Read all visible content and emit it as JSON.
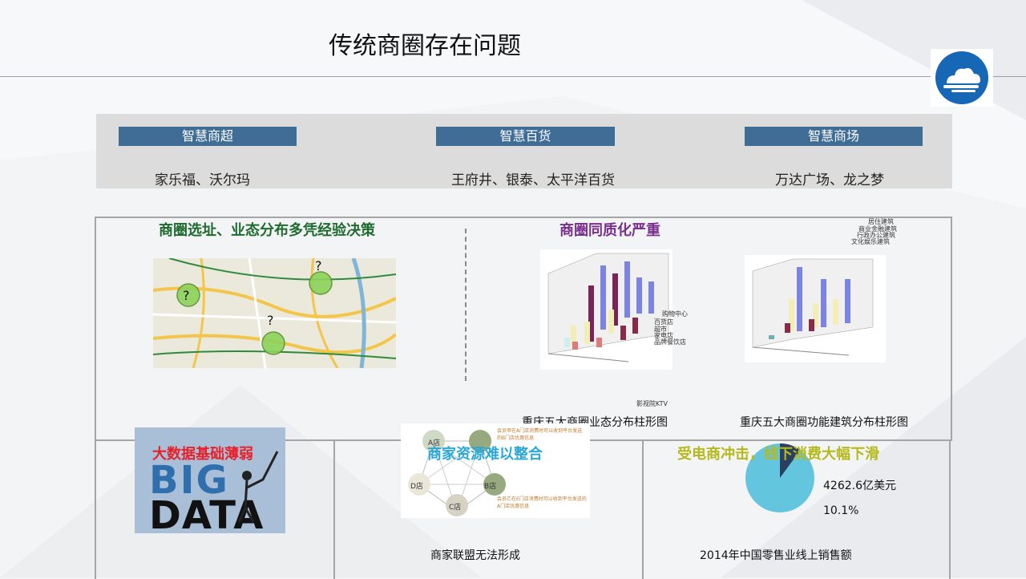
{
  "slide": {
    "title": "传统商圈存在问题"
  },
  "categories": [
    {
      "tag": "智慧商超",
      "examples": "家乐福、沃尔玛"
    },
    {
      "tag": "智慧百货",
      "examples": "王府井、银泰、太平洋百货"
    },
    {
      "tag": "智慧商场",
      "examples": "万达广场、龙之梦"
    }
  ],
  "problems": {
    "site_selection": {
      "heading": "商圈选址、业态分布多凭经验决策",
      "color": "#1e6b2e",
      "map_marks": [
        "?",
        "?",
        "?"
      ]
    },
    "homogenization": {
      "heading": "商圈同质化严重",
      "color": "#7a2f8f",
      "chart1_caption": "重庆五大商圈业态分布柱形图",
      "chart2_caption": "重庆五大商圈功能建筑分布柱形图",
      "chart1_legend": [
        "购物中心",
        "百货店",
        "超市",
        "家电店",
        "品牌餐饮店"
      ],
      "chart2_legend": [
        "居住建筑",
        "商业金融建筑",
        "行政办公建筑",
        "文化娱乐建筑"
      ],
      "stray_label": "影视院KTV"
    },
    "big_data": {
      "heading": "大数据基础薄弱",
      "color": "#e8202a",
      "image_text_1": "BIG",
      "image_text_2": "DATA"
    },
    "merchant_resources": {
      "heading": "商家资源难以整合",
      "color": "#29a8d8",
      "caption": "商家联盟无法形成",
      "nodes": [
        "A店",
        "B店",
        "C店",
        "D店"
      ],
      "note_top": "会员甲在A门店消费时可以收到平台发送的B门店优惠信息",
      "note_bottom": "会员乙在E门店消费时可以收到平台发送的A门店优惠信息"
    },
    "ecommerce": {
      "heading": "受电商冲击，线下消费大幅下滑",
      "color": "#b6b91b",
      "value": "4262.6亿美元",
      "percent": "10.1%",
      "share": 0.101,
      "caption": "2014年中国零售业线上销售额"
    }
  },
  "colors": {
    "tag_bg": "#3f6d96",
    "band_bg": "#dcdcdc",
    "logo": "#1767b7"
  },
  "icons": [
    "cloud-logo-icon"
  ]
}
